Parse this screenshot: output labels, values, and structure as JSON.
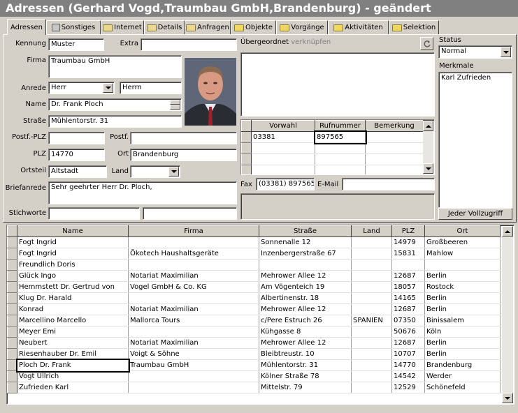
{
  "window": {
    "title": "Adressen (Gerhard Vogd,Traumbau GmbH,Brandenburg) - geändert"
  },
  "tabs": [
    {
      "label": "Adressen",
      "icon": "none",
      "active": true
    },
    {
      "label": "Sonstiges",
      "icon": "book-icon"
    },
    {
      "label": "Internet",
      "icon": "folder-icon"
    },
    {
      "label": "Details",
      "icon": "folder-icon"
    },
    {
      "label": "Anfragen",
      "icon": "folder-icon"
    },
    {
      "label": "Objekte",
      "icon": "folder-open-icon"
    },
    {
      "label": "Vorgänge",
      "icon": "folder-open-icon"
    },
    {
      "label": "Aktivitäten",
      "icon": "folder-open-icon"
    },
    {
      "label": "Selektion",
      "icon": "folder-open-icon"
    }
  ],
  "form": {
    "kennung_label": "Kennung",
    "kennung_value": "Muster",
    "extra_label": "Extra",
    "extra_value": "",
    "firma_label": "Firma",
    "firma_value": "Traumbau GmbH",
    "anrede_label": "Anrede",
    "anrede_value": "Herr",
    "anrede2_value": "Herrn",
    "name_label": "Name",
    "name_value": "Dr. Frank Ploch",
    "strasse_label": "Straße",
    "strasse_value": "Mühlentorstr. 31",
    "postf_plz_label": "Postf.-PLZ",
    "postf_plz_value": "",
    "postf_label": "Postf.",
    "postf_value": "",
    "plz_label": "PLZ",
    "plz_value": "14770",
    "ort_label": "Ort",
    "ort_value": "Brandenburg",
    "ortsteil_label": "Ortsteil",
    "ortsteil_value": "Altstadt",
    "land_label": "Land",
    "land_value": "",
    "briefanrede_label": "Briefanrede",
    "briefanrede_value": "Sehr geehrter Herr Dr. Ploch,",
    "stichworte_label": "Stichworte",
    "stichworte_value1": "",
    "stichworte_value2": ""
  },
  "uebergeordnet": {
    "label": "Übergeordnet",
    "link": "verknüpfen"
  },
  "phone_grid": {
    "columns": [
      "Vorwahl",
      "Rufnummer",
      "Bemerkung"
    ],
    "rows": [
      [
        "03381",
        "897565",
        ""
      ],
      [
        "",
        "",
        ""
      ],
      [
        "",
        "",
        ""
      ],
      [
        "",
        "",
        ""
      ]
    ]
  },
  "fax": {
    "label": "Fax",
    "value": "(03381) 897565"
  },
  "email": {
    "label": "E-Mail",
    "value": ""
  },
  "status": {
    "label": "Status",
    "value": "Normal"
  },
  "merkmale": {
    "label": "Merkmale",
    "items": [
      "Karl Zufrieden"
    ],
    "footer": "Jeder Vollzugriff"
  },
  "list": {
    "columns": [
      "Name",
      "Firma",
      "Straße",
      "Land",
      "PLZ",
      "Ort"
    ],
    "rows": [
      [
        "Fogt Ingrid",
        "",
        "Sonnenalle 12",
        "",
        "14979",
        "Großbeeren"
      ],
      [
        "Fogt Ingrid",
        "Ökotech Haushaltsgeräte",
        "Inzenbergerstraße 67",
        "",
        "15831",
        "Mahlow"
      ],
      [
        "Freundlich Doris",
        "",
        "",
        "",
        "",
        ""
      ],
      [
        "Glück Ingo",
        "Notariat Maximilian",
        "Mehrower Allee 12",
        "",
        "12687",
        "Berlin"
      ],
      [
        "Hemmstett Dr. Gertrud von",
        "Vogel GmbH & Co. KG",
        "Am Vögenteich 19",
        "",
        "18057",
        "Rostock"
      ],
      [
        "Klug Dr. Harald",
        "",
        "Albertinenstr. 18",
        "",
        "14165",
        "Berlin"
      ],
      [
        "Konrad",
        "Notariat Maximilian",
        "Mehrower Allee 12",
        "",
        "12687",
        "Berlin"
      ],
      [
        "Marcellino Marcello",
        "Mallorca Tours",
        "c/Pere Estruch 26",
        "SPANIEN",
        "07350",
        "Binissalem"
      ],
      [
        "Meyer Emi",
        "",
        "Kühgasse 8",
        "",
        "50676",
        "Köln"
      ],
      [
        "Neubert",
        "Notariat Maximilian",
        "Mehrower Allee 12",
        "",
        "12687",
        "Berlin"
      ],
      [
        "Riesenhauber Dr. Emil",
        "Voigt & Söhne",
        "Bleibtreustr. 10",
        "",
        "10707",
        "Berlin"
      ],
      [
        "Ploch Dr. Frank",
        "Traumbau GmbH",
        "Mühlentorstr. 31",
        "",
        "14770",
        "Brandenburg"
      ],
      [
        "Vogt Ullrich",
        "",
        "Kölner Straße 78",
        "",
        "14542",
        "Werder"
      ],
      [
        "Zufrieden Karl",
        "",
        "Mittelstr. 79",
        "",
        "12529",
        "Schönefeld"
      ]
    ],
    "selected_row": 11
  }
}
